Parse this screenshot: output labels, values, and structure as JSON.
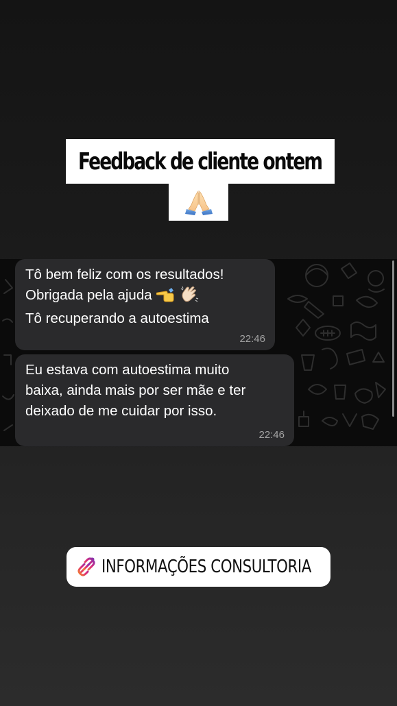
{
  "story": {
    "title_text": "Feedback de cliente ontem",
    "title_emoji": "folded-hands-emoji"
  },
  "chat": {
    "messages": [
      {
        "lines": [
          "Tô bem feliz com os resultados!",
          "Obrigada pela ajuda",
          "Tô recuperando a autoestima"
        ],
        "emojis": [
          "backhand-index-pointing-left-emoji",
          "clapping-hands-emoji"
        ],
        "time": "22:46"
      },
      {
        "lines": [
          "Eu estava com autoestima muito",
          "baixa, ainda mais por ser mãe e ter",
          "deixado de me cuidar por isso."
        ],
        "time": "22:46"
      }
    ]
  },
  "link_sticker": {
    "icon": "link-icon",
    "label": "INFORMAÇÕES CONSULTORIA"
  },
  "colors": {
    "background": "#1a1a1a",
    "bubble": "#2a2a2c",
    "chat_wallpaper": "#0b0b0b",
    "timestamp": "#a3a3a3",
    "link_gradient_start": "#f58529",
    "link_gradient_mid": "#dd2a7b",
    "link_gradient_end": "#8134af"
  }
}
